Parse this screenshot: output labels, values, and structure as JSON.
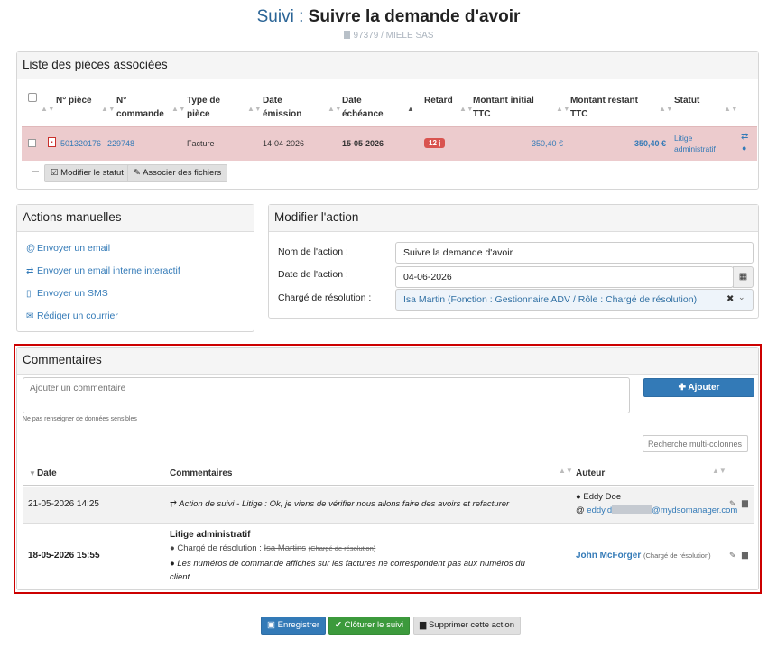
{
  "header": {
    "prefix": "Suivi :",
    "title": "Suivre la demande d'avoir",
    "subtitle": "97379 / MIELE SAS"
  },
  "pieces": {
    "title": "Liste des pièces associées",
    "columns": {
      "num_piece": "N° pièce",
      "num_commande_1": "N°",
      "num_commande_2": "commande",
      "type_1": "Type de",
      "type_2": "pièce",
      "date_emission_1": "Date",
      "date_emission_2": "émission",
      "date_echeance_1": "Date",
      "date_echeance_2": "échéance",
      "retard": "Retard",
      "montant_initial_1": "Montant initial",
      "montant_initial_2": "TTC",
      "montant_restant_1": "Montant restant",
      "montant_restant_2": "TTC",
      "statut": "Statut"
    },
    "row": {
      "num_piece": "501320176",
      "num_commande": "229748",
      "type": "Facture",
      "date_emission": "14-04-2026",
      "date_echeance": "15-05-2026",
      "retard": "12 j",
      "montant_initial": "350,40 €",
      "montant_restant": "350,40 €",
      "statut_1": "Litige",
      "statut_2": "administratif"
    },
    "btn_modifier": "Modifier le statut",
    "btn_associer": "Associer des fichiers"
  },
  "actions": {
    "title": "Actions manuelles",
    "items": [
      {
        "label": "Envoyer un email"
      },
      {
        "label": "Envoyer un email interne interactif"
      },
      {
        "label": "Envoyer un SMS"
      },
      {
        "label": "Rédiger un courrier"
      }
    ]
  },
  "form": {
    "title": "Modifier l'action",
    "nom_label": "Nom de l'action :",
    "nom_value": "Suivre la demande d'avoir",
    "date_label": "Date de l'action :",
    "date_value": "04-06-2026",
    "charge_label": "Chargé de résolution :",
    "charge_value": "Isa Martin (Fonction : Gestionnaire ADV / Rôle : Chargé de résolution)"
  },
  "comments": {
    "title": "Commentaires",
    "placeholder": "Ajouter un commentaire",
    "hint": "Ne pas renseigner de données sensibles",
    "add_label": "Ajouter",
    "search_placeholder": "Recherche multi-colonnes",
    "col_date": "Date",
    "col_comment": "Commentaires",
    "col_author": "Auteur",
    "rows": [
      {
        "date": "21-05-2026 14:25",
        "text": "Action de suivi - Litige : Ok, je viens de vérifier nous allons faire des avoirs et refacturer",
        "author": "Eddy Doe",
        "email_start": "eddy.d",
        "email_end": "@mydsomanager.com"
      },
      {
        "date": "18-05-2026 15:55",
        "heading": "Litige administratif",
        "charge_label": "Chargé de résolution :",
        "charge_name": "Isa Martins",
        "charge_role": "(Chargé de résolution)",
        "text_1": "Les numéros de commande affichés sur les factures ne correspondent pas aux numéros du",
        "text_2": "client",
        "author": "John McForger",
        "author_role": "(Chargé de résolution)"
      }
    ]
  },
  "footer": {
    "save": "Enregistrer",
    "close": "Clôturer le suivi",
    "delete": "Supprimer cette action"
  },
  "colors": {
    "accent": "#337ab7",
    "pink_row": "#eccbcd",
    "danger": "#d9534f",
    "success": "#3c9a3c",
    "frame": "#cc0000"
  }
}
